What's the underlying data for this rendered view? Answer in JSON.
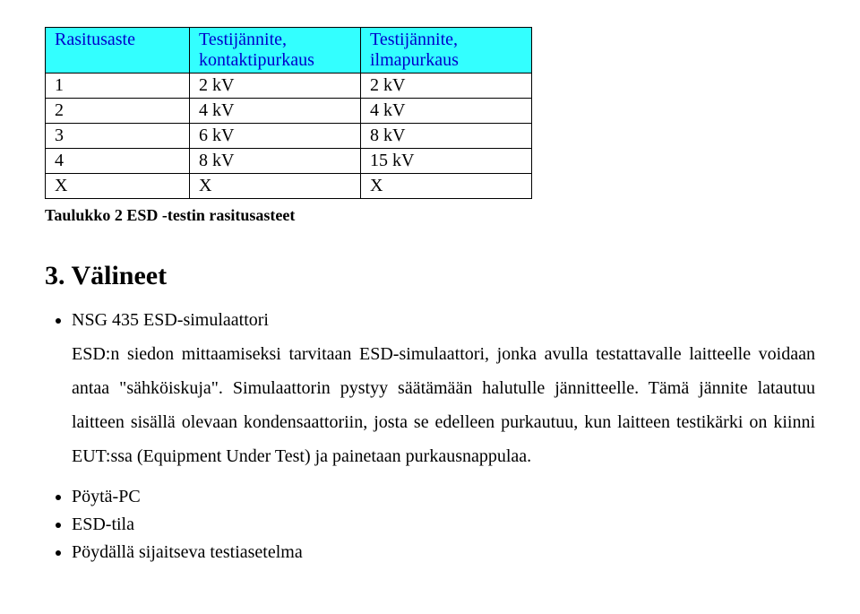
{
  "table": {
    "headers": [
      "Rasitusaste",
      "Testijännite, kontaktipurkaus",
      "Testijännite, ilmapurkaus"
    ],
    "rows": [
      [
        "1",
        "2 kV",
        "2 kV"
      ],
      [
        "2",
        "4 kV",
        "4 kV"
      ],
      [
        "3",
        "6 kV",
        "8 kV"
      ],
      [
        "4",
        "8 kV",
        "15 kV"
      ],
      [
        "X",
        "X",
        "X"
      ]
    ],
    "caption": "Taulukko 2 ESD -testin rasitusasteet"
  },
  "section": {
    "number": "3.",
    "title": "Välineet"
  },
  "bullets": {
    "b0": {
      "title": "NSG 435 ESD-simulaattori",
      "desc": "ESD:n siedon mittaamiseksi tarvitaan ESD-simulaattori, jonka avulla testattavalle laitteelle voidaan antaa \"sähköiskuja\". Simulaattorin pystyy säätämään halutulle jännitteelle. Tämä jännite latautuu laitteen sisällä olevaan kondensaattoriin, josta se edelleen purkautuu, kun laitteen testikärki on kiinni EUT:ssa (Equipment Under Test) ja painetaan purkausnappulaa."
    },
    "b1": {
      "title": "Pöytä-PC"
    },
    "b2": {
      "title": "ESD-tila"
    },
    "b3": {
      "title": "Pöydällä sijaitseva testiasetelma"
    }
  }
}
